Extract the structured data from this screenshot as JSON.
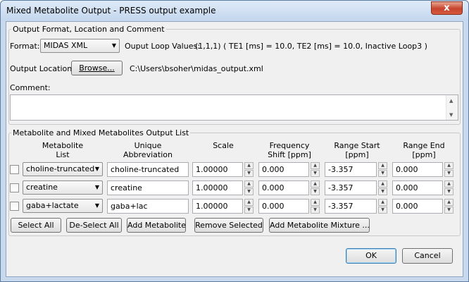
{
  "window": {
    "title": "Mixed Metabolite Output - PRESS output example",
    "close_glyph": "x"
  },
  "output_group": {
    "title": "Output Format, Location and Comment",
    "format_label": "Format:",
    "format_value": "MIDAS XML",
    "loop_values_label": "Ouput Loop Values:",
    "loop_values": "(1,1,1)  ( TE1 [ms] = 10.0, TE2 [ms] = 10.0, Inactive Loop3 )",
    "location_label": "Output Location:",
    "browse_label": "Browse...",
    "location_path": "C:\\Users\\bsoher\\midas_output.xml",
    "comment_label": "Comment:",
    "comment_value": ""
  },
  "metabolite_group": {
    "title": "Metabolite and Mixed Metabolites Output List",
    "headers": {
      "metabolite": [
        "Metabolite",
        "List"
      ],
      "abbreviation": [
        "Unique",
        "Abbreviation"
      ],
      "scale": [
        "Scale",
        ""
      ],
      "frequency": [
        "Frequency",
        "Shift [ppm]"
      ],
      "range_start": [
        "Range Start",
        "[ppm]"
      ],
      "range_end": [
        "Range End",
        "[ppm]"
      ]
    },
    "rows": [
      {
        "checked": false,
        "metabolite": "choline-truncated",
        "abbreviation": "choline-truncated",
        "scale": "1.00000",
        "frequency": "0.000",
        "range_start": "-3.357",
        "range_end": "0.000"
      },
      {
        "checked": false,
        "metabolite": "creatine",
        "abbreviation": "creatine",
        "scale": "1.00000",
        "frequency": "0.000",
        "range_start": "-3.357",
        "range_end": "0.000"
      },
      {
        "checked": false,
        "metabolite": "gaba+lactate",
        "abbreviation": "gaba+lac",
        "scale": "1.00000",
        "frequency": "0.000",
        "range_start": "-3.357",
        "range_end": "0.000"
      }
    ],
    "buttons": {
      "select_all": "Select All",
      "deselect_all": "De-Select All",
      "add_metabolite": "Add Metabolite",
      "remove_selected": "Remove Selected",
      "add_mixture": "Add Metabolite Mixture ..."
    }
  },
  "dialog_buttons": {
    "ok": "OK",
    "cancel": "Cancel"
  },
  "icons": {
    "dropdown": "chevron-down-icon",
    "spin_up": "triangle-up-icon",
    "spin_down": "triangle-down-icon"
  }
}
